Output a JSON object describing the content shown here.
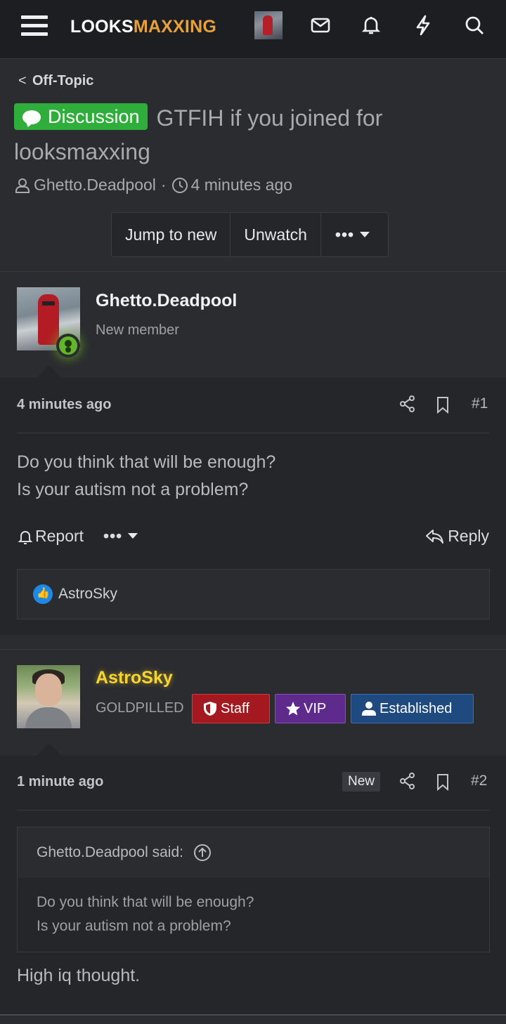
{
  "brand": {
    "logo_part1": "LOOKS",
    "logo_part2": "MAXXING"
  },
  "nav_icons": [
    "menu-icon",
    "mail-icon",
    "bell-icon",
    "lightning-icon",
    "search-icon"
  ],
  "breadcrumb": {
    "label": "Off-Topic"
  },
  "thread": {
    "prefix": "Discussion",
    "title": "GTFIH if you joined for looksmaxxing",
    "author": "Ghetto.Deadpool",
    "separator": "·",
    "time": "4 minutes ago",
    "buttons": {
      "jump": "Jump to new",
      "unwatch": "Unwatch",
      "more": "•••"
    }
  },
  "posts": [
    {
      "username": "Ghetto.Deadpool",
      "user_title": "New member",
      "time": "4 minutes ago",
      "number": "#1",
      "message_lines": [
        "Do you think that will be enough?",
        "Is your autism not a problem?"
      ],
      "actions": {
        "report": "Report",
        "more": "•••",
        "reply": "Reply"
      },
      "likes": "AstroSky"
    },
    {
      "username": "AstroSky",
      "user_title": "GOLDPILLED",
      "badges": {
        "staff": "Staff",
        "vip": "VIP",
        "established": "Established"
      },
      "time": "1 minute ago",
      "new_label": "New",
      "number": "#2",
      "quote": {
        "author_line": "Ghetto.Deadpool said:",
        "lines": [
          "Do you think that will be enough?",
          "Is your autism not a problem?"
        ]
      },
      "message": "High iq thought."
    }
  ],
  "colors": {
    "accent": "#e8a13a",
    "prefix": "#2fae3b",
    "gold_name": "#f6d431",
    "staff": "#a3191f",
    "vip": "#5e2a8c",
    "established": "#1f4a80"
  }
}
